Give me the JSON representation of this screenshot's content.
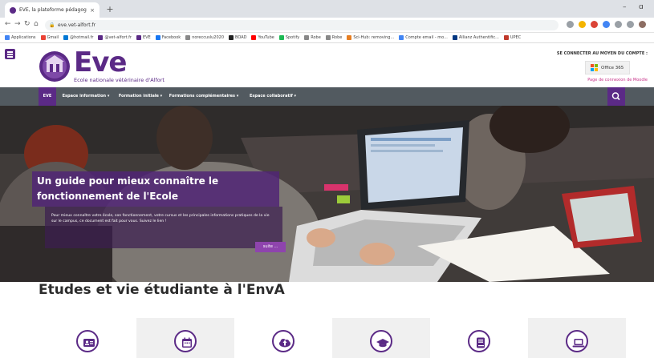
{
  "browser": {
    "tab_title": "EVE, la plateforme pédagogique",
    "tab_close": "×",
    "new_tab": "+",
    "url": "eve.vet-alfort.fr",
    "window_controls": {
      "minimize": "–",
      "restore": "ɑ"
    }
  },
  "bookmarks": [
    {
      "label": "Applications",
      "color": "#4285f4"
    },
    {
      "label": "Gmail",
      "color": "#ea4335"
    },
    {
      "label": "@hotmail.fr",
      "color": "#0078d4"
    },
    {
      "label": "@vet-alfort.fr",
      "color": "#5b2a86"
    },
    {
      "label": "EVE",
      "color": "#5b2a86"
    },
    {
      "label": "Facebook",
      "color": "#1877f2"
    },
    {
      "label": "noreccuslu2020",
      "color": "#888888"
    },
    {
      "label": "BOAD",
      "color": "#222222"
    },
    {
      "label": "YouTube",
      "color": "#ff0000"
    },
    {
      "label": "Spotify",
      "color": "#1db954"
    },
    {
      "label": "Robe",
      "color": "#888888"
    },
    {
      "label": "Robe",
      "color": "#888888"
    },
    {
      "label": "Sci-Hub: removing...",
      "color": "#e67e22"
    },
    {
      "label": "Compte email - mo...",
      "color": "#4285f4"
    },
    {
      "label": "Allianz Authentific...",
      "color": "#003781"
    },
    {
      "label": "UPEC",
      "color": "#c0392b"
    }
  ],
  "header": {
    "brand": "Eve",
    "brand_subtitle": "Ecole nationale vétérinaire d'Alfort",
    "connect_label": "SE CONNECTER AU MOYEN DU COMPTE :",
    "office_label": "Office 365",
    "moodle_link": "Page de connexion de Moodle"
  },
  "nav": {
    "items": [
      {
        "label": "EVE",
        "active": true
      },
      {
        "label": "Espace information ▾",
        "active": false
      },
      {
        "label": "Formation initiale ▾",
        "active": false
      },
      {
        "label": "Formations complémentaires ▾",
        "active": false
      },
      {
        "label": "Espace collaboratif ▾",
        "active": false
      }
    ]
  },
  "hero": {
    "caption": "Un guide pour mieux connaître le fonctionnement de l'Ecole",
    "body": "Pour mieux connaître votre école, son fonctionnement, votre cursus et les principales informations pratiques de la vie sur le campus, ce document est fait pour vous. Suivez le lien !",
    "button": "suite ..."
  },
  "main": {
    "section_title": "Etudes et vie étudiante à l'EnvA",
    "features": [
      {
        "icon": "id-card-icon"
      },
      {
        "icon": "calendar-icon"
      },
      {
        "icon": "cloud-upload-icon"
      },
      {
        "icon": "graduation-cap-icon"
      },
      {
        "icon": "book-icon"
      },
      {
        "icon": "laptop-icon"
      }
    ]
  },
  "colors": {
    "brand_purple": "#5b2a86",
    "nav_gray": "#525a60",
    "link_pink": "#c8338a"
  }
}
